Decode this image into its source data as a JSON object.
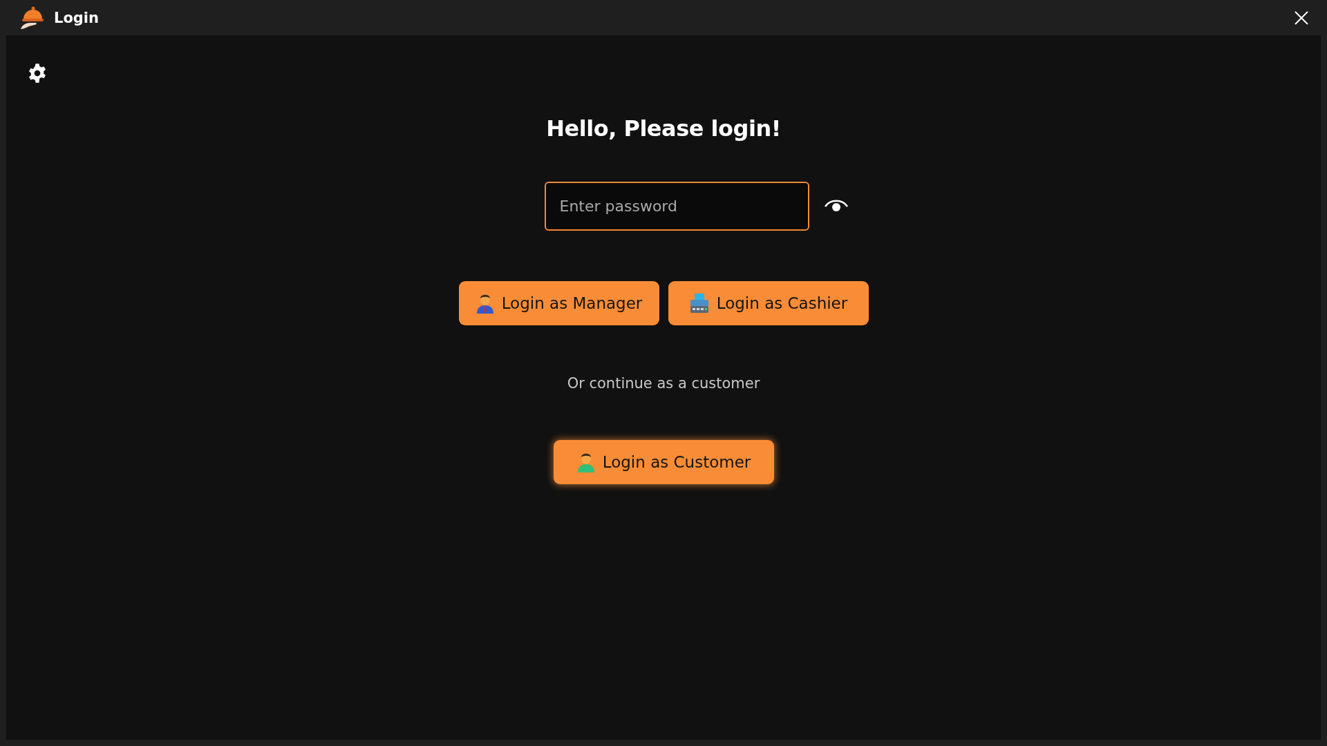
{
  "window": {
    "title": "Login"
  },
  "heading": "Hello, Please login!",
  "password": {
    "placeholder": "Enter password"
  },
  "staff_buttons": [
    {
      "kind": "manager",
      "label": "Login as Manager"
    },
    {
      "kind": "cashier",
      "label": "Login as Cashier"
    }
  ],
  "divider_text": "Or continue as a customer",
  "customer_button": {
    "kind": "customer",
    "label": "Login as Customer"
  }
}
